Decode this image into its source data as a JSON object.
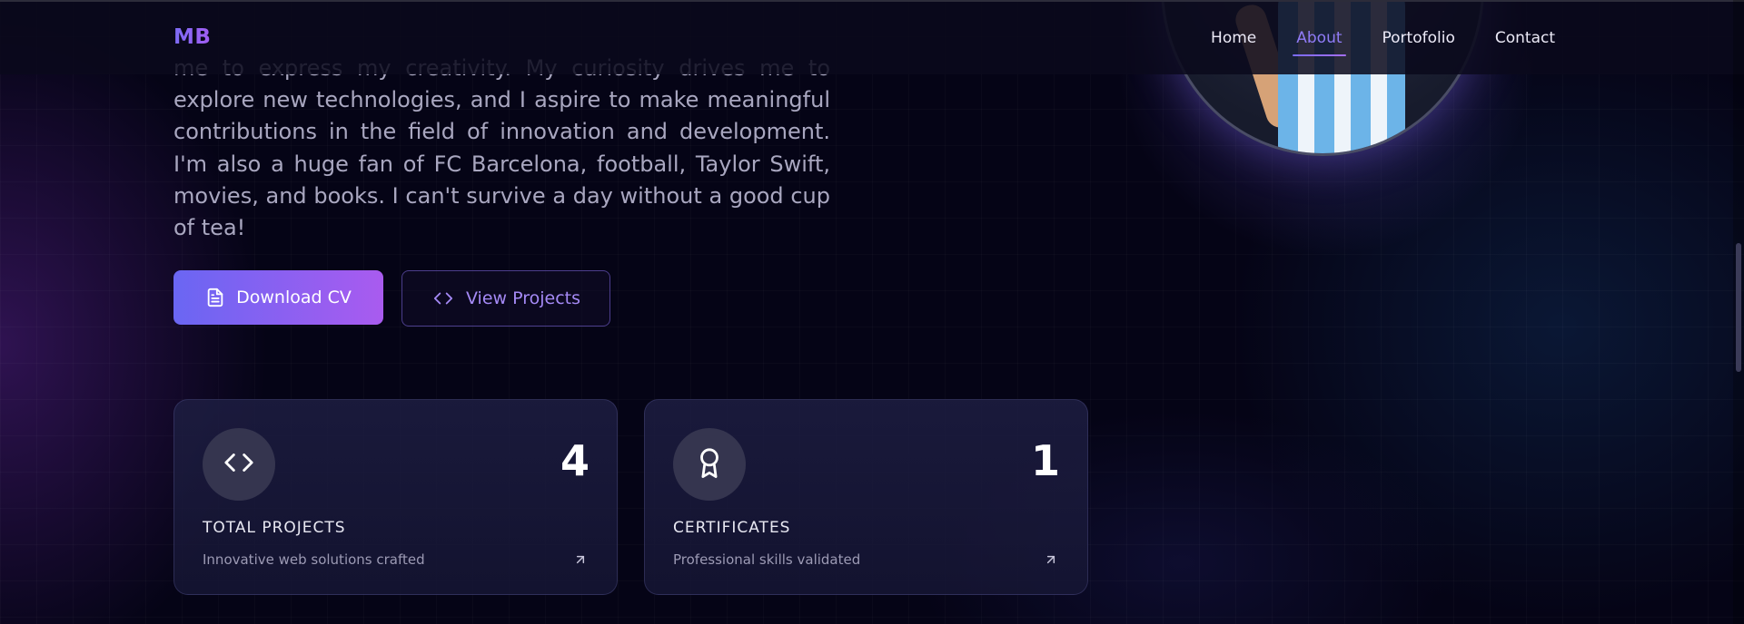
{
  "nav": {
    "logo": "MB",
    "links": [
      {
        "label": "Home"
      },
      {
        "label": "About"
      },
      {
        "label": "Portofolio"
      },
      {
        "label": "Contact"
      }
    ],
    "active": "About"
  },
  "about": {
    "bio": "me to express my creativity. My curiosity drives me to explore new technologies, and I aspire to make meaningful contributions in the field of innovation and development. I'm also a huge fan of FC Barcelona, football, Taylor Swift, movies, and books. I can't survive a day without a good cup of tea!",
    "download_cv_label": "Download CV",
    "view_projects_label": "View Projects"
  },
  "stats": [
    {
      "icon": "code-icon",
      "value": "4",
      "label": "TOTAL PROJECTS",
      "description": "Innovative web solutions crafted"
    },
    {
      "icon": "award-icon",
      "value": "1",
      "label": "CERTIFICATES",
      "description": "Professional skills validated"
    }
  ],
  "colors": {
    "accent": "#8f7bf6",
    "button_gradient_start": "#6a66f3",
    "button_gradient_end": "#a95bef",
    "background": "#050416"
  },
  "icons": [
    "file-text-icon",
    "code-icon",
    "award-icon",
    "arrow-up-right-icon"
  ]
}
